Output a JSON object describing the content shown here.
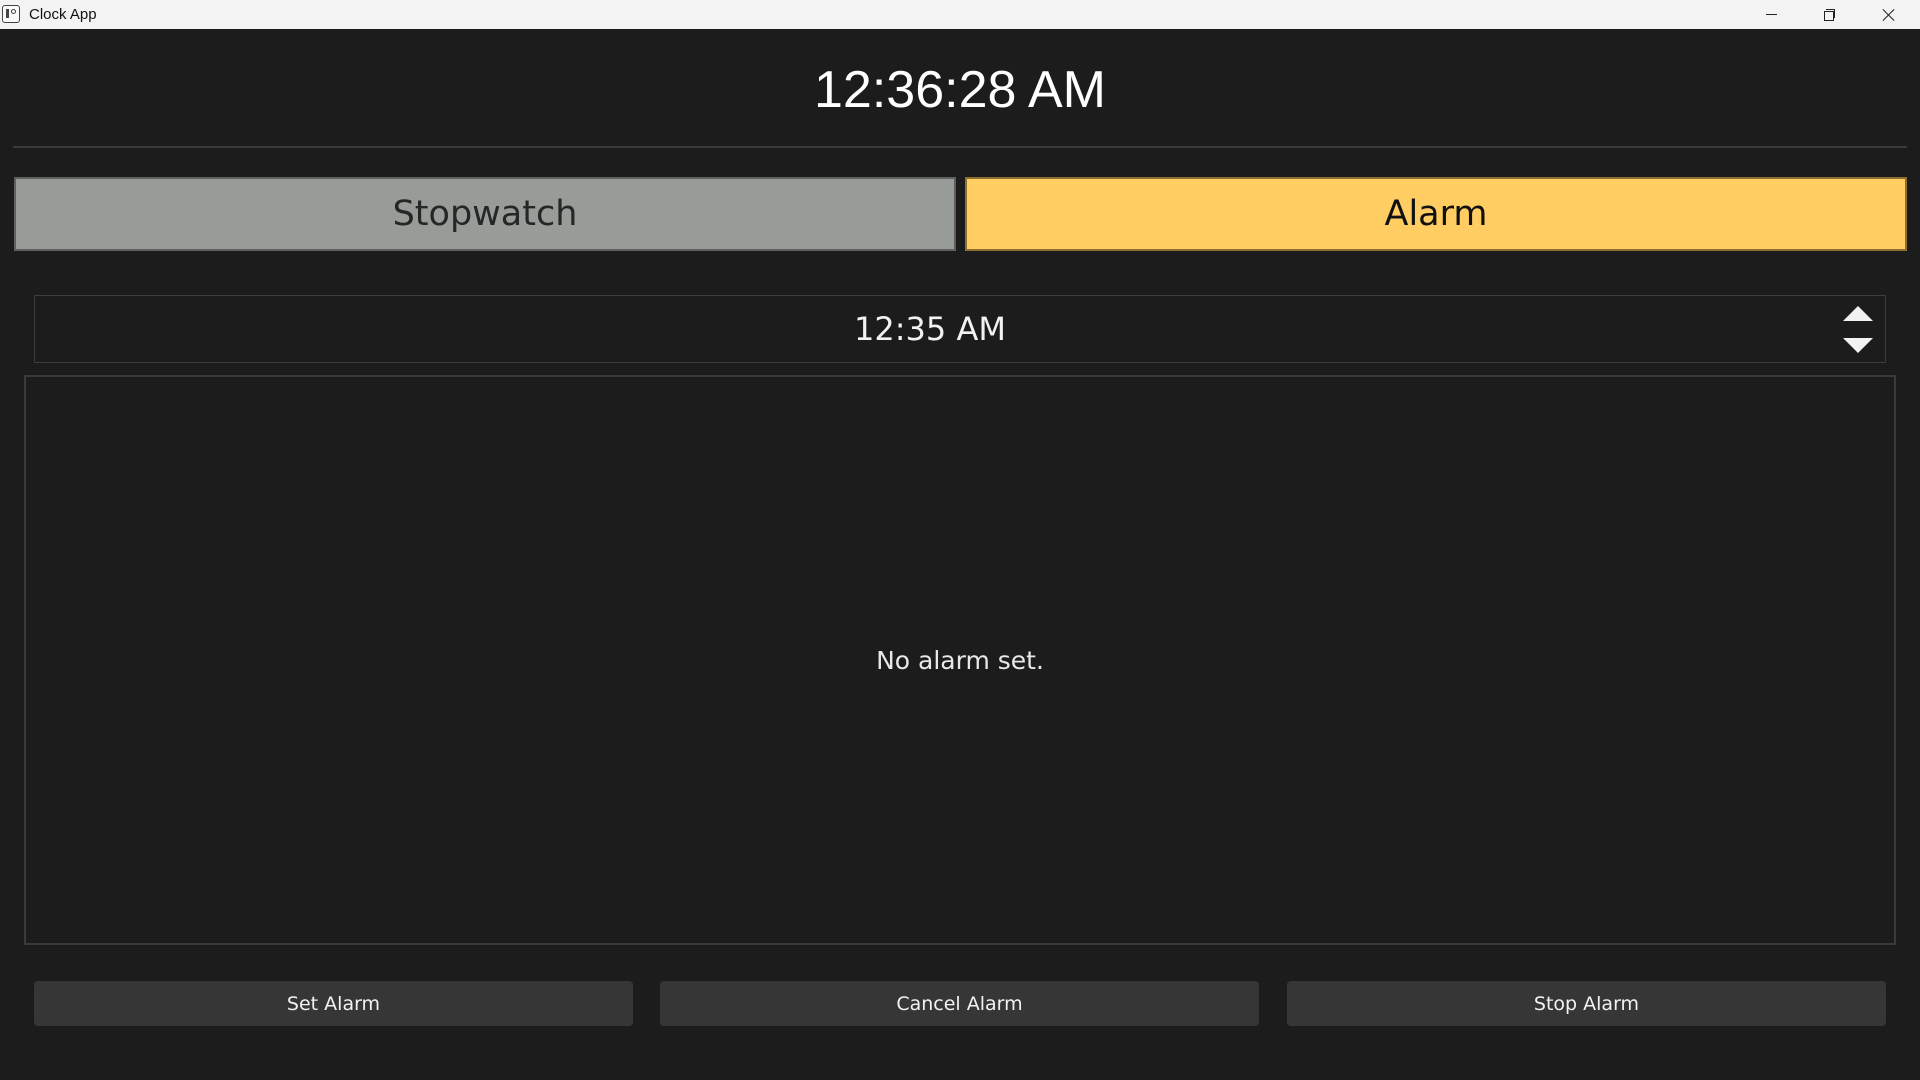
{
  "window": {
    "title": "Clock App",
    "icons": {
      "app": "clock-app-icon",
      "minimize": "minimize-icon",
      "maximize": "restore-icon",
      "close": "close-icon"
    }
  },
  "clock": {
    "current_time": "12:36:28 AM"
  },
  "tabs": [
    {
      "label": "Stopwatch",
      "active": false
    },
    {
      "label": "Alarm",
      "active": true
    }
  ],
  "alarm": {
    "time_value": "12:35 AM",
    "status": "No alarm set.",
    "buttons": {
      "set": "Set Alarm",
      "cancel": "Cancel Alarm",
      "stop": "Stop Alarm"
    }
  },
  "colors": {
    "background": "#1c1c1c",
    "tab_inactive": "#979c98",
    "tab_active": "#ffcd62",
    "button": "#363636",
    "text": "#f2f2f2"
  }
}
